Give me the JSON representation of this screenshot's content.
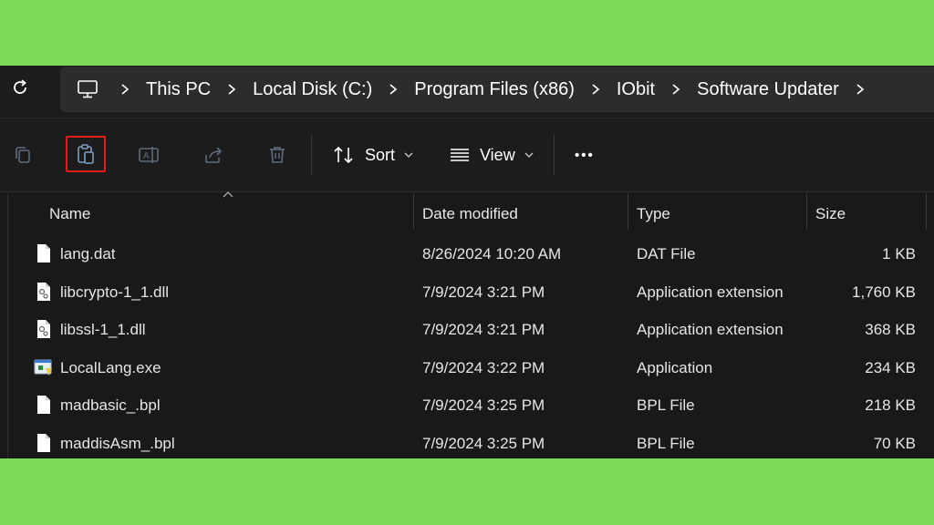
{
  "address_bar": {
    "crumbs": [
      "This PC",
      "Local Disk (C:)",
      "Program Files (x86)",
      "IObit",
      "Software Updater"
    ]
  },
  "toolbar": {
    "sort_label": "Sort",
    "view_label": "View",
    "more_label": "•••"
  },
  "columns": {
    "name": "Name",
    "date": "Date modified",
    "type": "Type",
    "size": "Size"
  },
  "files": [
    {
      "name": "lang.dat",
      "date": "8/26/2024 10:20 AM",
      "type": "DAT File",
      "size": "1 KB",
      "icon": "file-icon"
    },
    {
      "name": "libcrypto-1_1.dll",
      "date": "7/9/2024 3:21 PM",
      "type": "Application extension",
      "size": "1,760 KB",
      "icon": "dll-icon"
    },
    {
      "name": "libssl-1_1.dll",
      "date": "7/9/2024 3:21 PM",
      "type": "Application extension",
      "size": "368 KB",
      "icon": "dll-icon"
    },
    {
      "name": "LocalLang.exe",
      "date": "7/9/2024 3:22 PM",
      "type": "Application",
      "size": "234 KB",
      "icon": "exe-icon"
    },
    {
      "name": "madbasic_.bpl",
      "date": "7/9/2024 3:25 PM",
      "type": "BPL File",
      "size": "218 KB",
      "icon": "file-icon"
    },
    {
      "name": "maddisAsm_.bpl",
      "date": "7/9/2024 3:25 PM",
      "type": "BPL File",
      "size": "70 KB",
      "icon": "file-icon"
    }
  ],
  "colors": {
    "background": "#7ed957",
    "window": "#191919",
    "highlight": "#e21b1b"
  }
}
